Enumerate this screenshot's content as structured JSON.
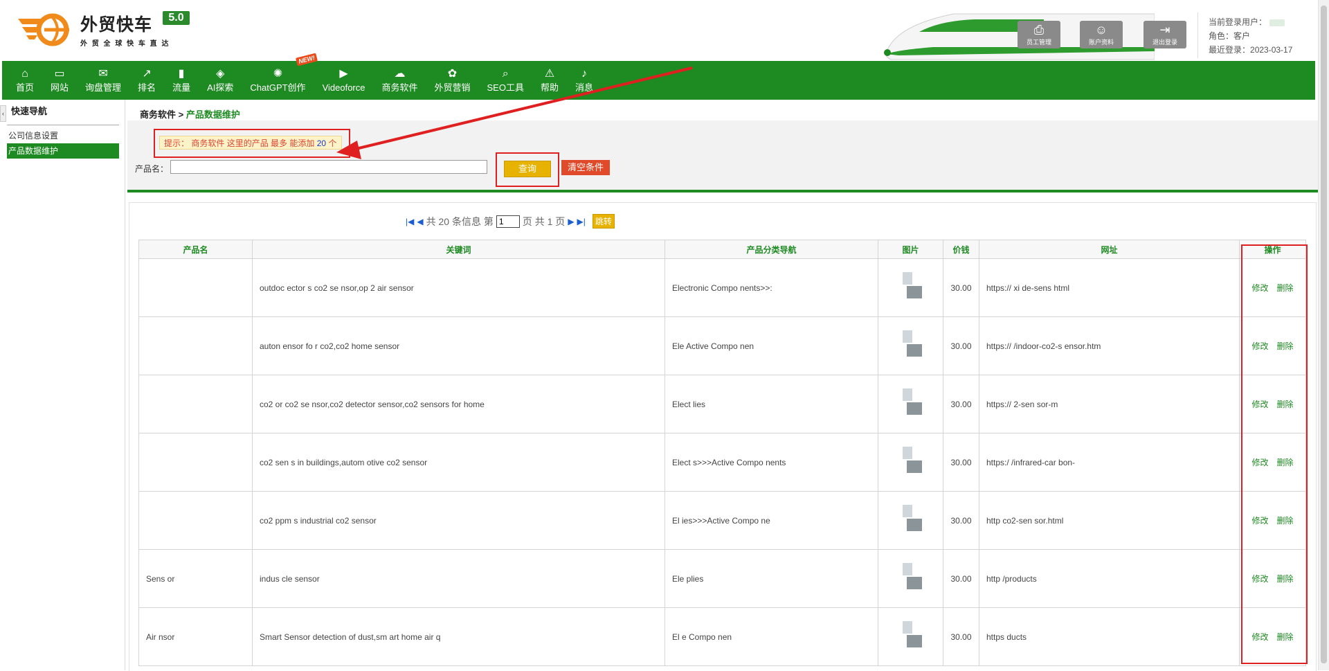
{
  "brand": {
    "title": "外贸快车",
    "version": "5.0",
    "subtitle": "外 贸 全 球   快 车 直 达",
    "primary_color": "#1e8a22",
    "accent_color": "#e8b200"
  },
  "header_buttons": [
    {
      "label": "员工管理",
      "icon": "staff-icon"
    },
    {
      "label": "账户资料",
      "icon": "account-icon"
    },
    {
      "label": "退出登录",
      "icon": "logout-icon"
    }
  ],
  "user": {
    "current_user_label": "当前登录用户：",
    "role_label": "角色：",
    "role": "客户",
    "last_login_label": "最近登录：",
    "last_login": "2023-03-17"
  },
  "nav": [
    {
      "label": "首页",
      "icon": "home-icon",
      "glyph": "⌂"
    },
    {
      "label": "网站",
      "icon": "monitor-icon",
      "glyph": "▭"
    },
    {
      "label": "询盘管理",
      "icon": "mail-icon",
      "glyph": "✉"
    },
    {
      "label": "排名",
      "icon": "ranking-icon",
      "glyph": "↗"
    },
    {
      "label": "流量",
      "icon": "traffic-icon",
      "glyph": "▮"
    },
    {
      "label": "AI探索",
      "icon": "ai-icon",
      "glyph": "◈"
    },
    {
      "label": "ChatGPT创作",
      "icon": "chatgpt-icon",
      "glyph": "✺"
    },
    {
      "label": "Videoforce",
      "icon": "video-icon",
      "glyph": "▶"
    },
    {
      "label": "商务软件",
      "icon": "software-icon",
      "glyph": "☁"
    },
    {
      "label": "外贸营销",
      "icon": "marketing-icon",
      "glyph": "✿"
    },
    {
      "label": "SEO工具",
      "icon": "search-icon",
      "glyph": "⌕"
    },
    {
      "label": "帮助",
      "icon": "help-icon",
      "glyph": "⚠"
    },
    {
      "label": "消息",
      "icon": "bell-icon",
      "glyph": "♪"
    }
  ],
  "new_badge": "NEW!",
  "sidebar": {
    "title": "快速导航",
    "items": [
      {
        "label": "公司信息设置",
        "active": false
      },
      {
        "label": "产品数据维护",
        "active": true
      }
    ]
  },
  "breadcrumb": {
    "parent": "商务软件",
    "separator": " > ",
    "current": "产品数据维护"
  },
  "tip": {
    "prefix": "提示：",
    "text": "商务软件 这里的产品 最多 能添加",
    "num": "20",
    "suffix": "个"
  },
  "filter": {
    "label": "产品名：",
    "value": "",
    "query_button": "查询",
    "clear_button": "清空条件"
  },
  "pager": {
    "total_text": "共 20 条信息 第",
    "page_value": "1",
    "page_suffix": "页 共 1 页",
    "jump": "跳转"
  },
  "table": {
    "headers": [
      "产品名",
      "关键词",
      "产品分类导航",
      "图片",
      "价钱",
      "网址",
      "操作"
    ],
    "rows": [
      {
        "name": "",
        "keywords": "outdoc                    ector s                                   co2 se nsor,op                        2 air sensor",
        "category": "Electronic                              Compo nents>>:",
        "price": "30.00",
        "url": "https://                                                          xi de-sens                 html",
        "edit": "修改",
        "delete": "删除"
      },
      {
        "name": "",
        "keywords": "auton                                                              ensor fo r co2,co2 home sensor",
        "category": "Ele                              Active Compo nen",
        "price": "30.00",
        "url": "https://                                            /indoor-co2-s ensor.htm",
        "edit": "修改",
        "delete": "删除"
      },
      {
        "name": "",
        "keywords": "co2                                                                  or co2 se nsor,co2 detector sensor,co2 sensors for home",
        "category": "Elect                      lies",
        "price": "30.00",
        "url": "https://                                               2-sen sor-m",
        "edit": "修改",
        "delete": "删除"
      },
      {
        "name": "",
        "keywords": "co2 sen                                       s in buildings,autom otive co2 sensor",
        "category": "Elect                    s>>>Active Compo nents",
        "price": "30.00",
        "url": "https:/                                      /infrared-car bon-",
        "edit": "修改",
        "delete": "删除"
      },
      {
        "name": "",
        "keywords": "co2 ppm s                                          industrial co2 sensor",
        "category": "El                      ies>>>Active Compo ne",
        "price": "30.00",
        "url": "http                                            co2-sen sor.html",
        "edit": "修改",
        "delete": "删除"
      },
      {
        "name": "                         Sens or",
        "keywords": "indus                                               cle sensor",
        "category": "Ele                      plies",
        "price": "30.00",
        "url": "http                         /products",
        "edit": "修改",
        "delete": "删除"
      },
      {
        "name": "Air                  nsor",
        "keywords": "Smart Sensor                                   detection of dust,sm art home air q",
        "category": "El                        e Compo nen",
        "price": "30.00",
        "url": "https                          ducts",
        "edit": "修改",
        "delete": "删除"
      }
    ]
  }
}
